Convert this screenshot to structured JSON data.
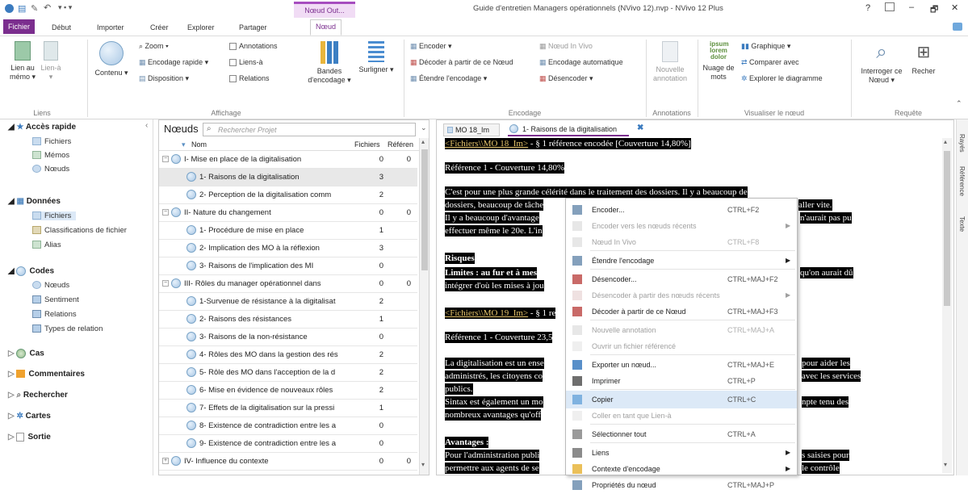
{
  "window": {
    "title": "Guide d'entretien Managers opérationnels (NVivo 12).nvp - NVivo 12 Plus",
    "context_tab_group": "Nœud Out...",
    "help": "?",
    "minimize": "–",
    "maximize": "🗗",
    "close": "✕"
  },
  "tabs": [
    "Fichier",
    "Début",
    "Importer",
    "Créer",
    "Explorer",
    "Partager",
    "Nœud"
  ],
  "ribbon": {
    "liens": {
      "label": "Lien au mémo ▾",
      "label2": "Lien-à ▾",
      "group": "Liens"
    },
    "contenu": {
      "label": "Contenu ▾"
    },
    "zoom": "Zoom ▾",
    "encodage_rapide": "Encodage rapide ▾",
    "disposition": "Disposition ▾",
    "annotations": "Annotations",
    "liens_a": "Liens-à",
    "relations": "Relations",
    "affichage_group": "Affichage",
    "bandes": "Bandes d'encodage ▾",
    "surligner": "Surligner ▾",
    "encoder": "Encoder ▾",
    "decoder": "Décoder à partir de ce Nœud",
    "etendre": "Étendre l'encodage ▾",
    "noeud_in_vivo": "Nœud In Vivo",
    "encodage_auto": "Encodage automatique",
    "desencoder": "Désencoder ▾",
    "encodage_group": "Encodage",
    "nouvelle_annotation": "Nouvelle annotation",
    "annotations_group": "Annotations",
    "nuage": "Nuage de mots",
    "graphique": "Graphique ▾",
    "comparer": "Comparer avec",
    "explorer_diag": "Explorer le diagramme",
    "visualiser_group": "Visualiser le nœud",
    "interroger": "Interroger ce Nœud ▾",
    "rechercher": "Recher",
    "requete_group": "Requête"
  },
  "nav": {
    "acces_rapide": "Accès rapide",
    "fichiers1": "Fichiers",
    "memos": "Mémos",
    "noeuds1": "Nœuds",
    "donnees": "Données",
    "fichiers2": "Fichiers",
    "classifications": "Classifications de fichier",
    "alias": "Alias",
    "codes": "Codes",
    "noeuds2": "Nœuds",
    "sentiment": "Sentiment",
    "relations": "Relations",
    "types_relation": "Types de relation",
    "cas": "Cas",
    "commentaires": "Commentaires",
    "rechercher": "Rechercher",
    "cartes": "Cartes",
    "sortie": "Sortie"
  },
  "nodes_panel": {
    "title": "Nœuds",
    "search_placeholder": "Rechercher Projet",
    "col_nom": "Nom",
    "col_fichiers": "Fichiers",
    "col_references": "Référen",
    "rows": [
      {
        "name": "I- Mise en place de la digitalisation",
        "f": "0",
        "r": "0",
        "lvl": 0,
        "exp": "−"
      },
      {
        "name": "1- Raisons de la digitalisation",
        "f": "3",
        "r": "",
        "lvl": 1
      },
      {
        "name": "2- Perception de la digitalisation comm",
        "f": "2",
        "r": "",
        "lvl": 1
      },
      {
        "name": "II- Nature du changement",
        "f": "0",
        "r": "0",
        "lvl": 0,
        "exp": "−"
      },
      {
        "name": "1- Procédure de mise en place",
        "f": "1",
        "r": "",
        "lvl": 1
      },
      {
        "name": "2- Implication des MO à la réflexion",
        "f": "3",
        "r": "",
        "lvl": 1
      },
      {
        "name": "3- Raisons de l'implication des MI",
        "f": "0",
        "r": "",
        "lvl": 1
      },
      {
        "name": "III- Rôles du manager opérationnel dans",
        "f": "0",
        "r": "0",
        "lvl": 0,
        "exp": "−"
      },
      {
        "name": "1-Survenue de résistance à la digitalisat",
        "f": "2",
        "r": "",
        "lvl": 1
      },
      {
        "name": "2- Raisons des résistances",
        "f": "1",
        "r": "",
        "lvl": 1
      },
      {
        "name": "3- Raisons de la non-résistance",
        "f": "0",
        "r": "",
        "lvl": 1
      },
      {
        "name": "4- Rôles des MO dans la gestion des rés",
        "f": "2",
        "r": "",
        "lvl": 1
      },
      {
        "name": "5- Rôle des MO dans l'acception de la d",
        "f": "2",
        "r": "",
        "lvl": 1
      },
      {
        "name": "6- Mise en évidence de nouveaux rôles",
        "f": "2",
        "r": "",
        "lvl": 1
      },
      {
        "name": "7- Effets de la digitalisation sur la pressi",
        "f": "1",
        "r": "",
        "lvl": 1
      },
      {
        "name": "8- Existence de contradiction entre les a",
        "f": "0",
        "r": "",
        "lvl": 1
      },
      {
        "name": "9- Existence de contradiction entre les a",
        "f": "0",
        "r": "",
        "lvl": 1
      },
      {
        "name": "IV- Influence du contexte",
        "f": "0",
        "r": "0",
        "lvl": 0,
        "exp": "+"
      }
    ]
  },
  "doc": {
    "tab1": "MO 18_Im",
    "tab2": "1- Raisons de la digitalisation",
    "l1_link": "<Fichiers\\\\MO 18_Im>",
    "l1_rest": " - § 1 référence encodée  [Couverture 14,80%]",
    "ref1": "Référence 1 - Couverture 14,80%",
    "p1a": "C'est pour une plus grande célérité dans le traitement des dossiers. Il y a beaucoup de",
    "p1b_left": "dossiers, beaucoup de tâche",
    "p1b_right": "aller vite.",
    "p1c_left": "Il y a beaucoup d'avantage",
    "p1c_right": "n'aurait pas pu",
    "p1d_left": "effectuer même le 20e. L'in",
    "risques": "Risques",
    "lim_left": "Limites : au fur et à mes",
    "lim_right": "qu'on aurait dû",
    "lim2_left": "intégrer d'où les mises à jou",
    "l2_link": "<Fichiers\\\\MO 19_Im>",
    "l2_rest": " - § 1 re",
    "ref2": "Référence 1 - Couverture 23,5",
    "p2a_left": "La digitalisation est un ense",
    "p2a_right": "pour aider les",
    "p2b_left": "administrés, les citoyens co",
    "p2b_right": "avec les services",
    "p2c": "publics.",
    "p2d_left": "Sintax est également un mo",
    "p2d_right": "npte tenu des",
    "p2e_left": "nombreux avantages qu'off",
    "avantages": "Avantages :",
    "p3a_left": "Pour l'administration publi",
    "p3a_right": "s saisies pour",
    "p3b_left": "permettre aux agents de se",
    "p3b_right": "le contrôle"
  },
  "context_menu": {
    "items": [
      {
        "label": "Encoder...",
        "sc": "CTRL+F2",
        "dis": false
      },
      {
        "label": "Encoder vers les nœuds récents",
        "sc": "",
        "dis": true,
        "arrow": true
      },
      {
        "label": "Nœud In Vivo",
        "sc": "CTRL+F8",
        "dis": true
      },
      {
        "label": "Étendre l'encodage",
        "sc": "",
        "dis": false,
        "arrow": true
      },
      {
        "label": "Désencoder...",
        "sc": "CTRL+MAJ+F2",
        "dis": false
      },
      {
        "label": "Désencoder à partir des nœuds récents",
        "sc": "",
        "dis": true,
        "arrow": true
      },
      {
        "label": "Décoder à partir de ce Nœud",
        "sc": "CTRL+MAJ+F3",
        "dis": false
      },
      {
        "label": "Nouvelle annotation",
        "sc": "CTRL+MAJ+A",
        "dis": true
      },
      {
        "label": "Ouvrir un fichier référencé",
        "sc": "",
        "dis": true
      },
      {
        "label": "Exporter un nœud...",
        "sc": "CTRL+MAJ+E",
        "dis": false
      },
      {
        "label": "Imprimer",
        "sc": "CTRL+P",
        "dis": false
      },
      {
        "label": "Copier",
        "sc": "CTRL+C",
        "dis": false,
        "hl": true
      },
      {
        "label": "Coller en tant que Lien-à",
        "sc": "",
        "dis": true
      },
      {
        "label": "Sélectionner tout",
        "sc": "CTRL+A",
        "dis": false
      },
      {
        "label": "Liens",
        "sc": "",
        "dis": false,
        "arrow": true
      },
      {
        "label": "Contexte d'encodage",
        "sc": "",
        "dis": false,
        "arrow": true
      },
      {
        "label": "Propriétés du nœud",
        "sc": "CTRL+MAJ+P",
        "dis": false
      }
    ]
  },
  "right_sidebar": {
    "a": "Rayés",
    "b": "Référence",
    "c": "Texte"
  },
  "colors": {
    "accent": "#7b2e8e",
    "highlight": "#dce9f7",
    "doc_bg": "#000000",
    "link": "#e8c66c"
  }
}
